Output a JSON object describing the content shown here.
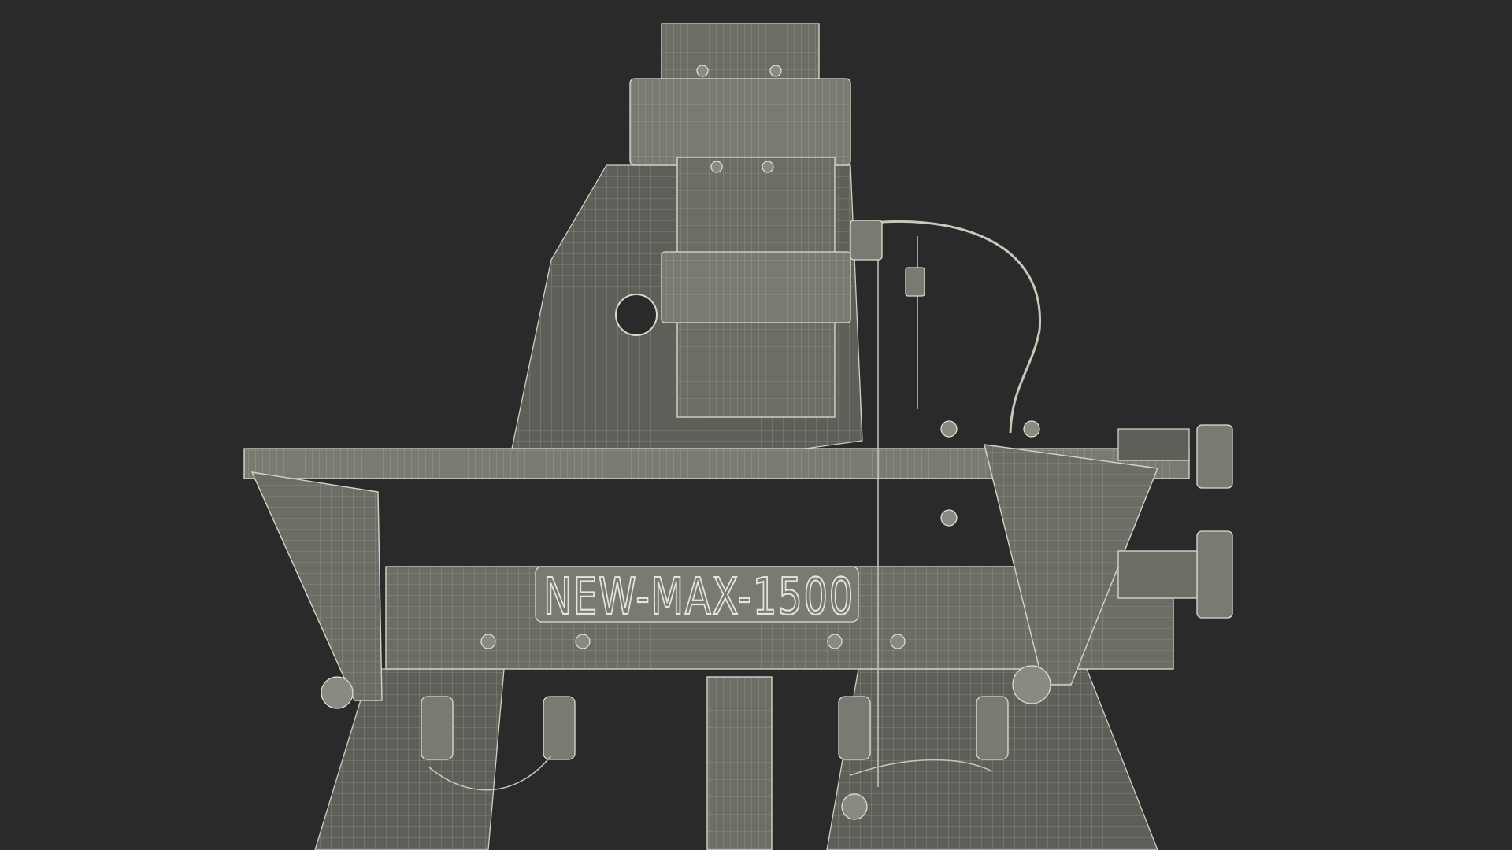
{
  "scene": {
    "background_color": "#2a2a2a",
    "wire_color": "#d4d4c6",
    "surface_color": "#6d6d66",
    "nameplate_text": "NEW-MAX-1500"
  }
}
